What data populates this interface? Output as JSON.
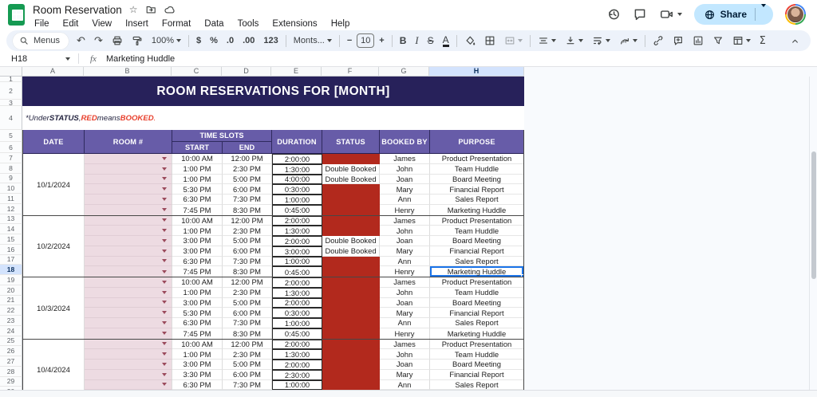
{
  "app": {
    "title": "Room Reservation",
    "menus": [
      "File",
      "Edit",
      "View",
      "Insert",
      "Format",
      "Data",
      "Tools",
      "Extensions",
      "Help"
    ],
    "share_label": "Share"
  },
  "toolbar": {
    "menus_label": "Menus",
    "zoom": "100%",
    "currency": "$",
    "percent": "%",
    "decrease_decimals": ".0",
    "increase_decimals": ".00",
    "more_formats": "123",
    "font": "Monts...",
    "font_size": "10",
    "decrease_font": "−",
    "increase_font": "+",
    "bold": "B",
    "italic": "I",
    "strikethrough": "S",
    "text_color": "A",
    "functions": "Σ"
  },
  "formula_bar": {
    "cell_ref": "H18",
    "fx_label": "fx",
    "value": "Marketing Huddle"
  },
  "grid": {
    "columns": [
      "A",
      "B",
      "C",
      "D",
      "E",
      "F",
      "G",
      "H"
    ],
    "selected_column": "H",
    "selected_row": 18,
    "banner": "ROOM RESERVATIONS FOR [MONTH]",
    "note_segments": [
      {
        "text": "*Under ",
        "style": "i"
      },
      {
        "text": "STATUS",
        "style": "bi"
      },
      {
        "text": ", ",
        "style": "i"
      },
      {
        "text": "RED",
        "style": "bir"
      },
      {
        "text": " means ",
        "style": "i"
      },
      {
        "text": "BOOKED",
        "style": "bir"
      },
      {
        "text": ".",
        "style": "ir"
      }
    ],
    "header": {
      "date": "DATE",
      "room": "ROOM #",
      "time_slots": "TIME SLOTS",
      "start": "START",
      "end": "END",
      "duration": "DURATION",
      "status": "STATUS",
      "booked_by": "BOOKED BY",
      "purpose": "PURPOSE"
    },
    "labels": {
      "double_booked": "Double Booked"
    },
    "selection": {
      "cell": "H18",
      "row": 18,
      "value": "Marketing Huddle"
    },
    "groups": [
      {
        "date": "10/1/2024",
        "rows": [
          {
            "row": 7,
            "start": "10:00 AM",
            "end": "12:00 PM",
            "duration": "2:00:00",
            "status": "booked",
            "booked_by": "James",
            "purpose": "Product Presentation"
          },
          {
            "row": 8,
            "start": "1:00 PM",
            "end": "2:30 PM",
            "duration": "1:30:00",
            "status": "double_booked",
            "booked_by": "John",
            "purpose": "Team Huddle"
          },
          {
            "row": 9,
            "start": "1:00 PM",
            "end": "5:00 PM",
            "duration": "4:00:00",
            "status": "double_booked",
            "booked_by": "Joan",
            "purpose": "Board Meeting"
          },
          {
            "row": 10,
            "start": "5:30 PM",
            "end": "6:00 PM",
            "duration": "0:30:00",
            "status": "booked",
            "booked_by": "Mary",
            "purpose": "Financial Report"
          },
          {
            "row": 11,
            "start": "6:30 PM",
            "end": "7:30 PM",
            "duration": "1:00:00",
            "status": "booked",
            "booked_by": "Ann",
            "purpose": "Sales Report"
          },
          {
            "row": 12,
            "start": "7:45 PM",
            "end": "8:30 PM",
            "duration": "0:45:00",
            "status": "booked",
            "booked_by": "Henry",
            "purpose": "Marketing Huddle"
          }
        ]
      },
      {
        "date": "10/2/2024",
        "rows": [
          {
            "row": 13,
            "start": "10:00 AM",
            "end": "12:00 PM",
            "duration": "2:00:00",
            "status": "booked",
            "booked_by": "James",
            "purpose": "Product Presentation"
          },
          {
            "row": 14,
            "start": "1:00 PM",
            "end": "2:30 PM",
            "duration": "1:30:00",
            "status": "booked",
            "booked_by": "John",
            "purpose": "Team Huddle"
          },
          {
            "row": 15,
            "start": "3:00 PM",
            "end": "5:00 PM",
            "duration": "2:00:00",
            "status": "double_booked",
            "booked_by": "Joan",
            "purpose": "Board Meeting"
          },
          {
            "row": 16,
            "start": "3:00 PM",
            "end": "6:00 PM",
            "duration": "3:00:00",
            "status": "double_booked",
            "booked_by": "Mary",
            "purpose": "Financial Report"
          },
          {
            "row": 17,
            "start": "6:30 PM",
            "end": "7:30 PM",
            "duration": "1:00:00",
            "status": "booked",
            "booked_by": "Ann",
            "purpose": "Sales Report"
          },
          {
            "row": 18,
            "start": "7:45 PM",
            "end": "8:30 PM",
            "duration": "0:45:00",
            "status": "booked",
            "booked_by": "Henry",
            "purpose": "Marketing Huddle"
          }
        ]
      },
      {
        "date": "10/3/2024",
        "rows": [
          {
            "row": 19,
            "start": "10:00 AM",
            "end": "12:00 PM",
            "duration": "2:00:00",
            "status": "booked",
            "booked_by": "James",
            "purpose": "Product Presentation"
          },
          {
            "row": 20,
            "start": "1:00 PM",
            "end": "2:30 PM",
            "duration": "1:30:00",
            "status": "booked",
            "booked_by": "John",
            "purpose": "Team Huddle"
          },
          {
            "row": 21,
            "start": "3:00 PM",
            "end": "5:00 PM",
            "duration": "2:00:00",
            "status": "booked",
            "booked_by": "Joan",
            "purpose": "Board Meeting"
          },
          {
            "row": 22,
            "start": "5:30 PM",
            "end": "6:00 PM",
            "duration": "0:30:00",
            "status": "booked",
            "booked_by": "Mary",
            "purpose": "Financial Report"
          },
          {
            "row": 23,
            "start": "6:30 PM",
            "end": "7:30 PM",
            "duration": "1:00:00",
            "status": "booked",
            "booked_by": "Ann",
            "purpose": "Sales Report"
          },
          {
            "row": 24,
            "start": "7:45 PM",
            "end": "8:30 PM",
            "duration": "0:45:00",
            "status": "booked",
            "booked_by": "Henry",
            "purpose": "Marketing Huddle"
          }
        ]
      },
      {
        "date": "10/4/2024",
        "rows": [
          {
            "row": 25,
            "start": "10:00 AM",
            "end": "12:00 PM",
            "duration": "2:00:00",
            "status": "booked",
            "booked_by": "James",
            "purpose": "Product Presentation"
          },
          {
            "row": 26,
            "start": "1:00 PM",
            "end": "2:30 PM",
            "duration": "1:30:00",
            "status": "booked",
            "booked_by": "John",
            "purpose": "Team Huddle"
          },
          {
            "row": 27,
            "start": "3:00 PM",
            "end": "5:00 PM",
            "duration": "2:00:00",
            "status": "booked",
            "booked_by": "Joan",
            "purpose": "Board Meeting"
          },
          {
            "row": 28,
            "start": "3:30 PM",
            "end": "6:00 PM",
            "duration": "2:30:00",
            "status": "booked",
            "booked_by": "Mary",
            "purpose": "Financial Report"
          },
          {
            "row": 29,
            "start": "6:30 PM",
            "end": "7:30 PM",
            "duration": "1:00:00",
            "status": "booked",
            "booked_by": "Ann",
            "purpose": "Sales Report"
          },
          {
            "row": 30,
            "partial": true
          }
        ]
      }
    ]
  },
  "colors": {
    "banner_bg": "#27215A",
    "header_purple": "#675CA8",
    "booked_red": "#B2291D",
    "room_pink": "#EDDBE2",
    "selection_blue": "#1A73E8",
    "selected_header_bg": "#D3E3FD",
    "share_bg": "#C2E7FF",
    "share_text": "#001D35",
    "note_red": "#E8402D",
    "note_dark": "#23233F",
    "toolbar_bg": "#EDF2FA",
    "grid_void": "#F8FAFD",
    "line_dark": "#474747"
  }
}
